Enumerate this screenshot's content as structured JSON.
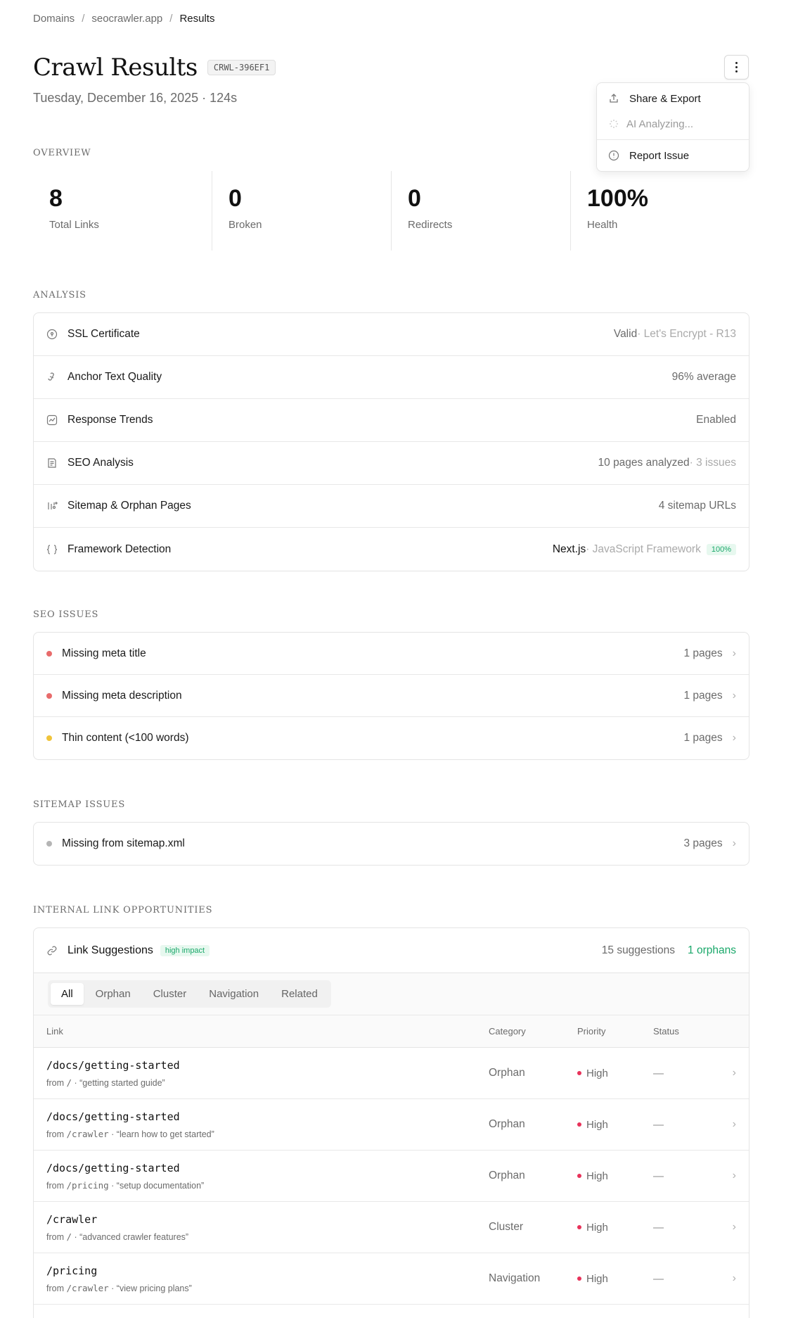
{
  "breadcrumb": {
    "items": [
      "Domains",
      "seocrawler.app"
    ],
    "current": "Results",
    "separator": "/"
  },
  "header": {
    "title": "Crawl Results",
    "crawl_id": "CRWL-396EF1",
    "subtitle": "Tuesday, December 16, 2025 · 124s"
  },
  "menu": {
    "items": {
      "share": "Share & Export",
      "ai": "AI Analyzing...",
      "report": "Report Issue"
    }
  },
  "overview": {
    "label": "OVERVIEW",
    "stats": [
      {
        "value": "8",
        "label": "Total Links"
      },
      {
        "value": "0",
        "label": "Broken"
      },
      {
        "value": "0",
        "label": "Redirects"
      },
      {
        "value": "100%",
        "label": "Health"
      }
    ]
  },
  "analysis": {
    "label": "ANALYSIS",
    "rows": [
      {
        "icon": "ssl-icon",
        "label": "SSL Certificate",
        "value": "Valid",
        "muted": " · Let's Encrypt - R13"
      },
      {
        "icon": "anchor-icon",
        "label": "Anchor Text Quality",
        "value": "96% average"
      },
      {
        "icon": "trend-icon",
        "label": "Response Trends",
        "value": "Enabled"
      },
      {
        "icon": "seo-icon",
        "label": "SEO Analysis",
        "value": "10 pages analyzed",
        "muted": " · 3 issues"
      },
      {
        "icon": "sitemap-icon",
        "label": "Sitemap & Orphan Pages",
        "value": "4 sitemap URLs"
      },
      {
        "icon": "braces-icon",
        "label": "Framework Detection",
        "value": "Next.js",
        "muted": " · JavaScript Framework",
        "badge": "100%"
      }
    ]
  },
  "seo_issues": {
    "label": "SEO ISSUES",
    "rows": [
      {
        "label": "Missing meta title",
        "count": "1 pages",
        "color": "#e86b6b"
      },
      {
        "label": "Missing meta description",
        "count": "1 pages",
        "color": "#e86b6b"
      },
      {
        "label": "Thin content (<100 words)",
        "count": "1 pages",
        "color": "#f0c43a"
      }
    ]
  },
  "sitemap_issues": {
    "label": "SITEMAP ISSUES",
    "rows": [
      {
        "label": "Missing from sitemap.xml",
        "count": "3 pages",
        "color": "#b5b5b5"
      }
    ]
  },
  "link_opportunities": {
    "label": "INTERNAL LINK OPPORTUNITIES",
    "title": "Link Suggestions",
    "impact": "high impact",
    "suggestions": "15 suggestions",
    "orphans": "1 orphans",
    "tabs": [
      "All",
      "Orphan",
      "Cluster",
      "Navigation",
      "Related"
    ],
    "columns": {
      "link": "Link",
      "category": "Category",
      "priority": "Priority",
      "status": "Status"
    },
    "rows": [
      {
        "path": "/docs/getting-started",
        "from_prefix": "from ",
        "from_path": "/",
        "anchor": " · “getting started guide”",
        "category": "Orphan",
        "priority": "High",
        "status": "—"
      },
      {
        "path": "/docs/getting-started",
        "from_prefix": "from ",
        "from_path": "/crawler",
        "anchor": " · “learn how to get started”",
        "category": "Orphan",
        "priority": "High",
        "status": "—"
      },
      {
        "path": "/docs/getting-started",
        "from_prefix": "from ",
        "from_path": "/pricing",
        "anchor": " · “setup documentation”",
        "category": "Orphan",
        "priority": "High",
        "status": "—"
      },
      {
        "path": "/crawler",
        "from_prefix": "from ",
        "from_path": "/",
        "anchor": " · “advanced crawler features”",
        "category": "Cluster",
        "priority": "High",
        "status": "—"
      },
      {
        "path": "/pricing",
        "from_prefix": "from ",
        "from_path": "/crawler",
        "anchor": " · “view pricing plans”",
        "category": "Navigation",
        "priority": "High",
        "status": "—"
      }
    ]
  }
}
